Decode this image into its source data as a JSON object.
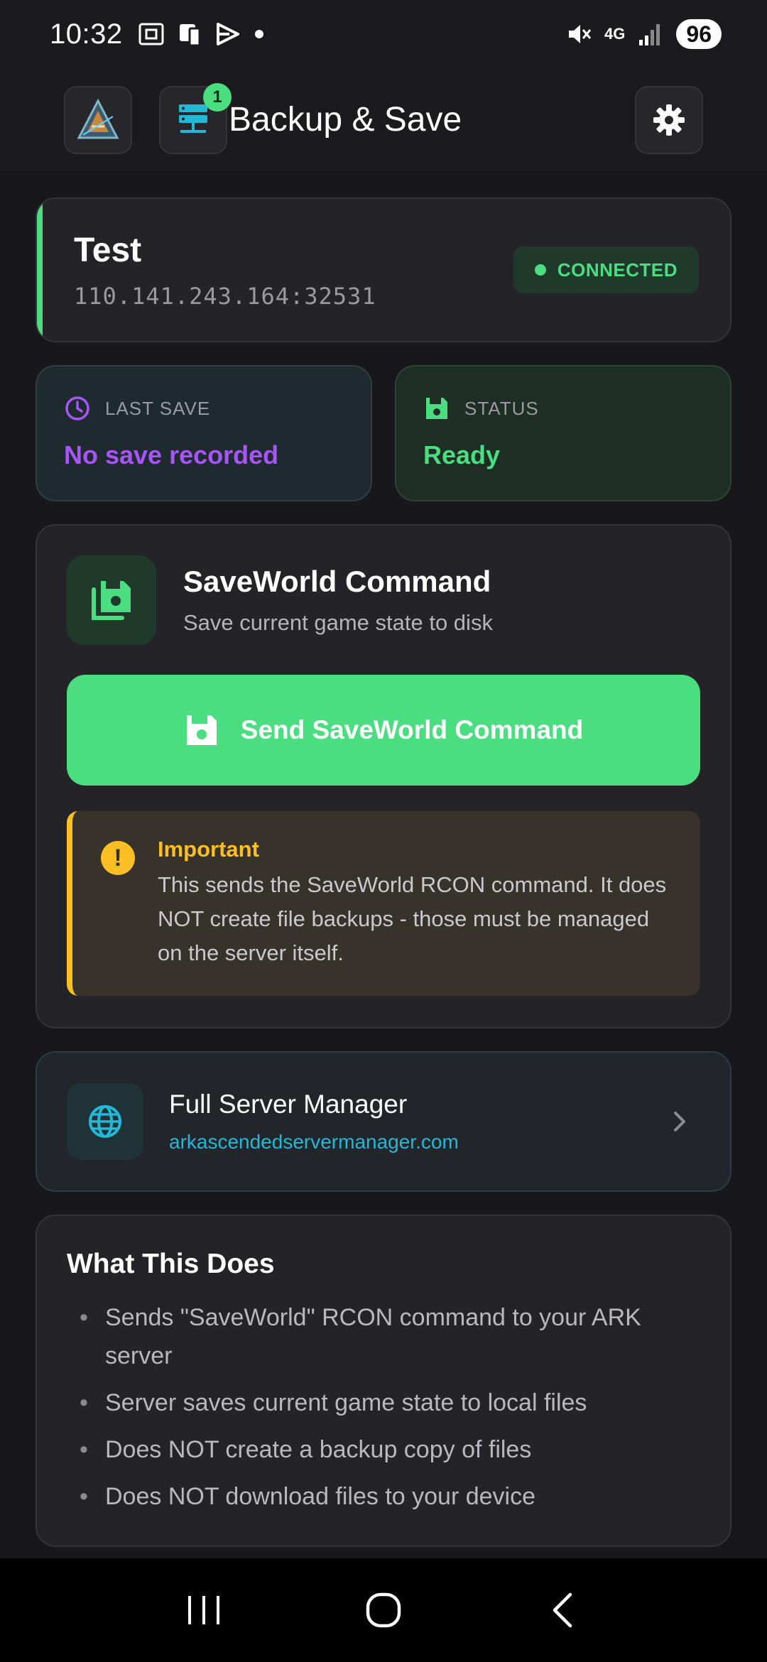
{
  "status_bar": {
    "time": "10:32",
    "network": "4G",
    "battery": "96"
  },
  "header": {
    "title": "Backup & Save",
    "server_badge_count": "1"
  },
  "server": {
    "name": "Test",
    "address": "110.141.243.164:32531",
    "connection_status": "CONNECTED",
    "accent_color": "#4ade80"
  },
  "stats": {
    "last_save": {
      "label": "LAST SAVE",
      "value": "No save recorded",
      "icon": "clock-icon",
      "color": "#a855f7"
    },
    "status": {
      "label": "STATUS",
      "value": "Ready",
      "icon": "floppy-disk-icon",
      "color": "#4ade80"
    }
  },
  "command_card": {
    "title": "SaveWorld Command",
    "subtitle": "Save current game state to disk",
    "button_label": "Send SaveWorld Command",
    "warning": {
      "title": "Important",
      "body": "This sends the SaveWorld RCON command. It does NOT create file backups - those must be managed on the server itself.",
      "color": "#fbbf24"
    }
  },
  "server_manager_link": {
    "title": "Full Server Manager",
    "url": "arkascendedservermanager.com",
    "url_color": "#22b8d8"
  },
  "info_card": {
    "title": "What This Does",
    "items": [
      "Sends \"SaveWorld\" RCON command to your ARK server",
      "Server saves current game state to local files",
      "Does NOT create a backup copy of files",
      "Does NOT download files to your device"
    ]
  }
}
